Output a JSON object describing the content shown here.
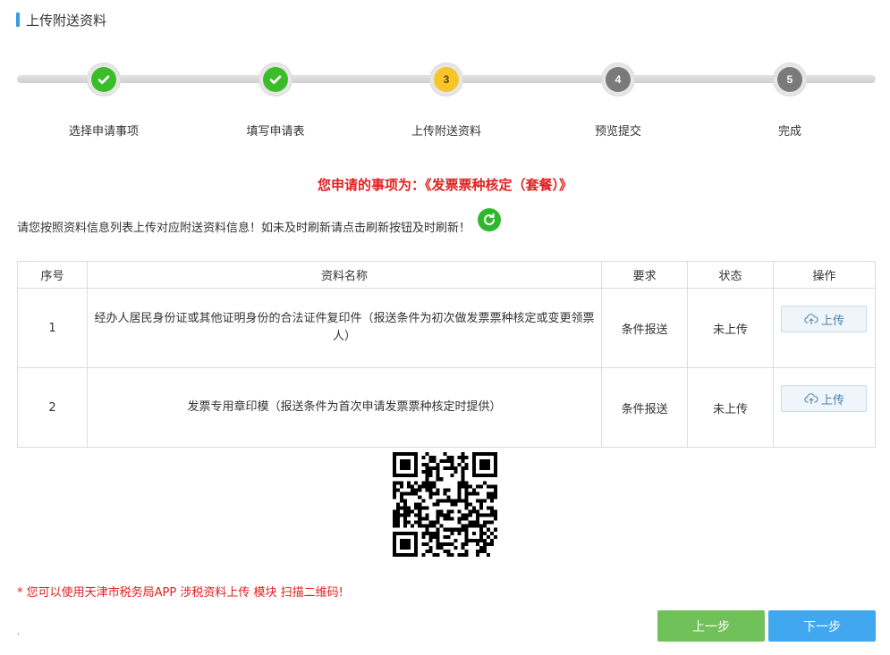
{
  "header": {
    "title": "上传附送资料"
  },
  "steps": [
    {
      "label": "选择申请事项",
      "status": "done"
    },
    {
      "label": "填写申请表",
      "status": "done"
    },
    {
      "label": "上传附送资料",
      "number": "3",
      "status": "current"
    },
    {
      "label": "预览提交",
      "number": "4",
      "status": "todo"
    },
    {
      "label": "完成",
      "number": "5",
      "status": "todo"
    }
  ],
  "headline": "您申请的事项为：《发票票种核定（套餐）》",
  "instruction": "请您按照资料信息列表上传对应附送资料信息！如未及时刷新请点击刷新按钮及时刷新！",
  "table": {
    "headers": [
      "序号",
      "资料名称",
      "要求",
      "状态",
      "操作"
    ],
    "rows": [
      {
        "no": "1",
        "name": "经办人居民身份证或其他证明身份的合法证件复印件（报送条件为初次做发票票种核定或变更领票人）",
        "requirement": "条件报送",
        "status": "未上传",
        "action": "上传"
      },
      {
        "no": "2",
        "name": "发票专用章印模（报送条件为首次申请发票票种核定时提供）",
        "requirement": "条件报送",
        "status": "未上传",
        "action": "上传"
      }
    ]
  },
  "hint": "* 您可以使用天津市税务局APP 涉税资料上传 模块 扫描二维码!",
  "footer_mark": ".",
  "buttons": {
    "prev": "上一步",
    "next": "下一步"
  },
  "colors": {
    "accent": "#3a9be0",
    "done": "#3bbd2b",
    "current": "#f7c52a",
    "todo": "#7a7a7a",
    "alert": "#e02020",
    "prev": "#71c15a",
    "next": "#41a8ef"
  }
}
